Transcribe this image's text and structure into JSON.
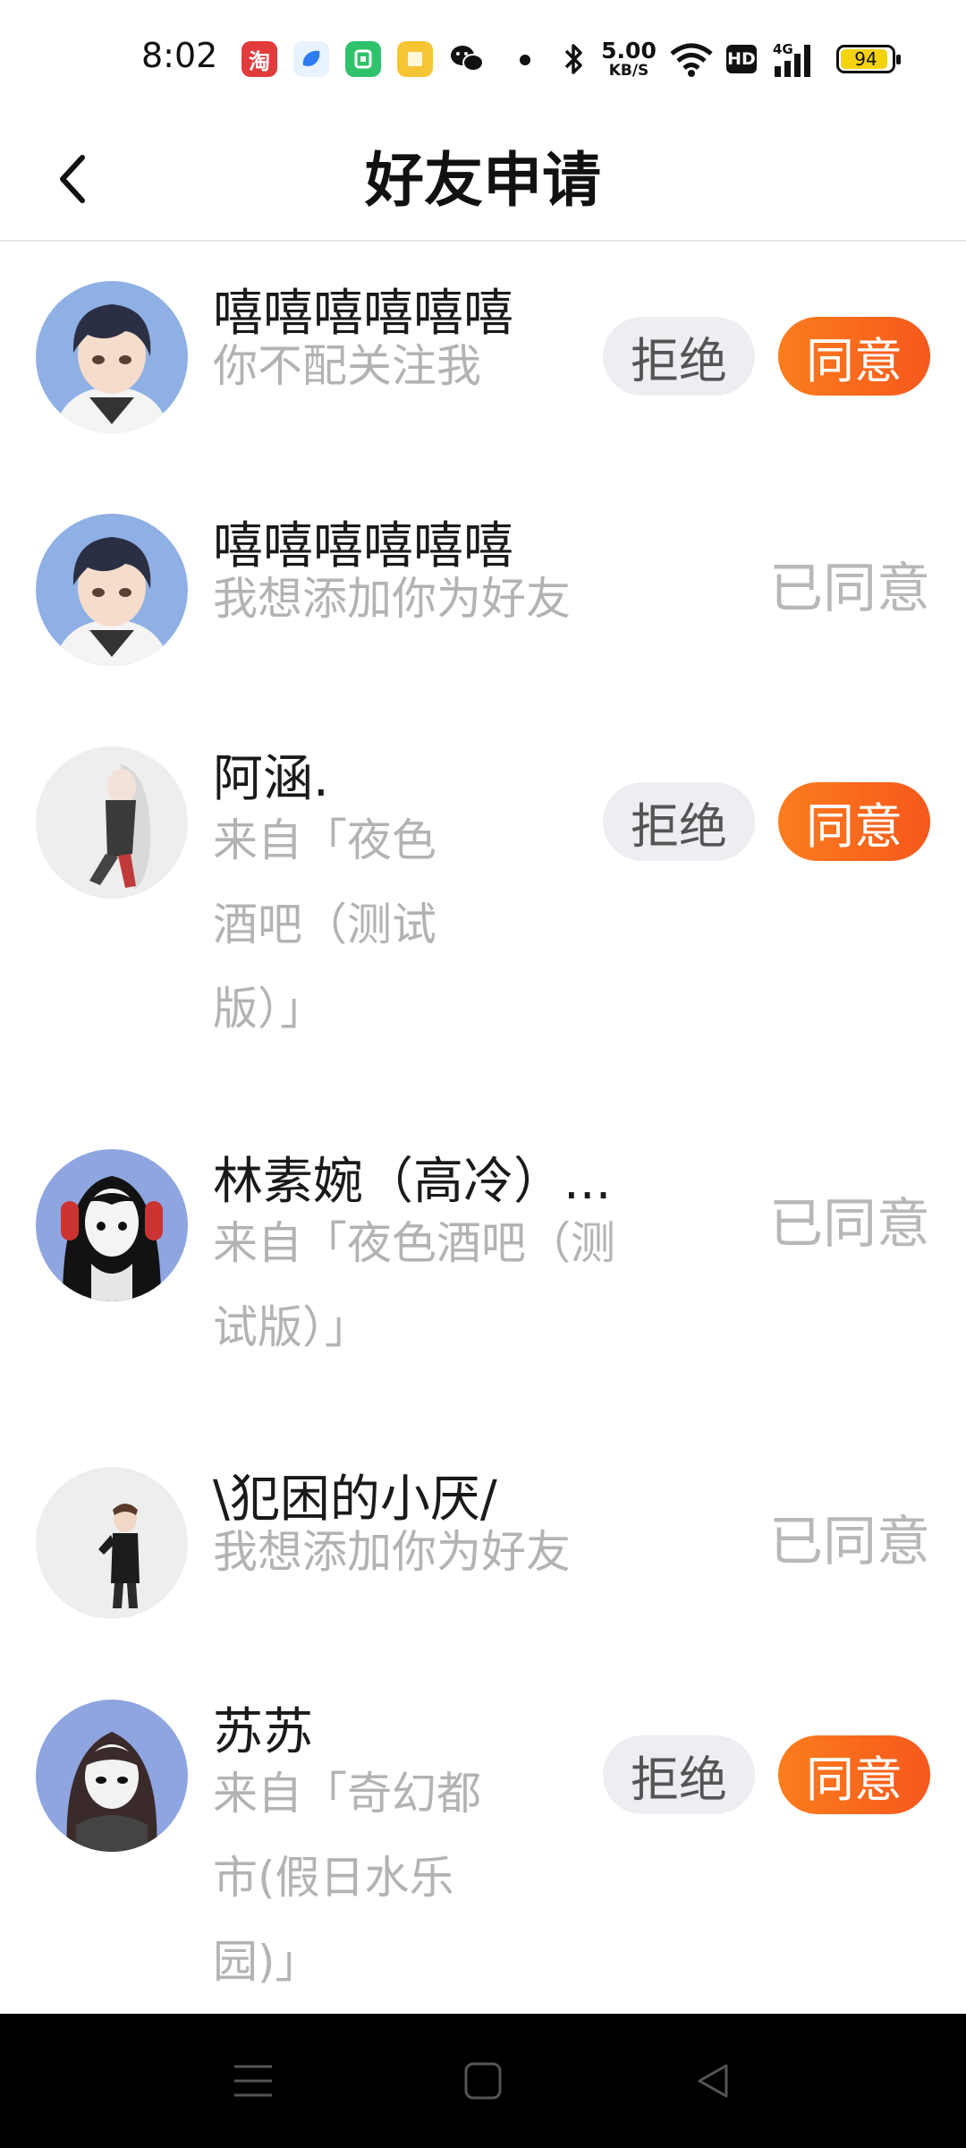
{
  "status_bar": {
    "time": "8:02",
    "taobao_glyph": "淘",
    "net_speed_value": "5.00",
    "net_speed_unit": "KB/S",
    "hd_label": "HD",
    "network_label": "4G",
    "battery_level": "94",
    "icons": [
      "taobao-app-icon",
      "blue-app-icon",
      "green-app-icon",
      "yellow-app-icon",
      "wechat-icon",
      "bluetooth-icon",
      "wifi-icon",
      "signal-icon",
      "battery-icon"
    ]
  },
  "header": {
    "title": "好友申请",
    "back_icon": "chevron-left-icon"
  },
  "actions": {
    "reject_label": "拒绝",
    "accept_label": "同意",
    "accepted_label": "已同意"
  },
  "requests": [
    {
      "name": "嘻嘻嘻嘻嘻嘻",
      "message": "你不配关注我",
      "status": "pending"
    },
    {
      "name": "嘻嘻嘻嘻嘻嘻",
      "message": "我想添加你为好友",
      "status": "accepted"
    },
    {
      "name": "阿涵.",
      "message_lines": [
        "来自「夜色",
        "酒吧（测试",
        "版）」"
      ],
      "status": "pending"
    },
    {
      "name": "林素婉（高冷）...",
      "message_lines": [
        "来自「夜色酒吧（测",
        "试版）」"
      ],
      "status": "accepted"
    },
    {
      "name": "\\犯困的小厌/",
      "message": "我想添加你为好友",
      "status": "accepted"
    },
    {
      "name": "苏苏",
      "message_lines": [
        "来自「奇幻都",
        "市(假日水乐",
        "园)」"
      ],
      "status": "pending"
    }
  ],
  "colors": {
    "accent_orange": "#f6581c",
    "reject_bg": "#eceef2",
    "muted_text": "#b3b3b3"
  },
  "nav_bar": {
    "icons": [
      "menu-icon",
      "home-square-icon",
      "back-triangle-icon"
    ]
  }
}
